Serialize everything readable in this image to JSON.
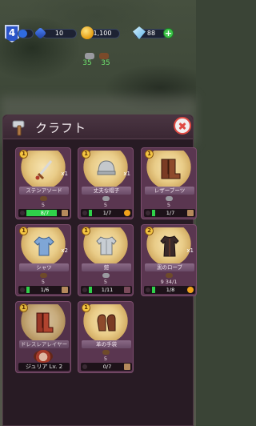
{
  "hud": {
    "level": "4",
    "gems": "10",
    "gold": "1,100",
    "diamonds": "88",
    "resource_a": "35",
    "resource_b": "35"
  },
  "panel": {
    "title": "クラフト"
  },
  "cards": [
    {
      "badge": "1",
      "qty": "x1",
      "name": "ステンアソード",
      "materials": "5",
      "progress": "8/7",
      "progress_fraction": 1.0,
      "footer_icon": "coin"
    },
    {
      "badge": "1",
      "qty": "x1",
      "name": "丈夫な帽子",
      "materials": "5",
      "progress": "1/7",
      "progress_fraction": 0.14,
      "footer_icon": "coin"
    },
    {
      "badge": "1",
      "qty": "",
      "name": "レザーブーツ",
      "materials": "5",
      "progress": "1/7",
      "progress_fraction": 0.14,
      "footer_icon": "square"
    },
    {
      "badge": "1",
      "qty": "x2",
      "name": "シャツ",
      "materials": "5",
      "progress": "1/6",
      "progress_fraction": 0.17,
      "footer_icon": "square"
    },
    {
      "badge": "1",
      "qty": "",
      "name": "鎧",
      "materials": "5",
      "progress": "1/11",
      "progress_fraction": 0.09,
      "footer_icon": "square"
    },
    {
      "badge": "2",
      "qty": "x1",
      "name": "黒のローブ",
      "materials": "9 34/1",
      "progress": "1/8",
      "progress_fraction": 0.13,
      "footer_icon": "coin"
    },
    {
      "badge": "1",
      "qty": "",
      "name": "ドレスレアレイヤー",
      "materials": "",
      "progress": "ジュリア Lv. 2",
      "progress_fraction": 0,
      "footer_icon": "none"
    },
    {
      "badge": "1",
      "qty": "",
      "name": "革の手袋",
      "materials": "5",
      "progress": "0/7",
      "progress_fraction": 0,
      "footer_icon": "square"
    }
  ],
  "colors": {
    "progress_green": "#2fd14a",
    "close_red": "#e04a42",
    "badge_gold": "#f4c542"
  }
}
